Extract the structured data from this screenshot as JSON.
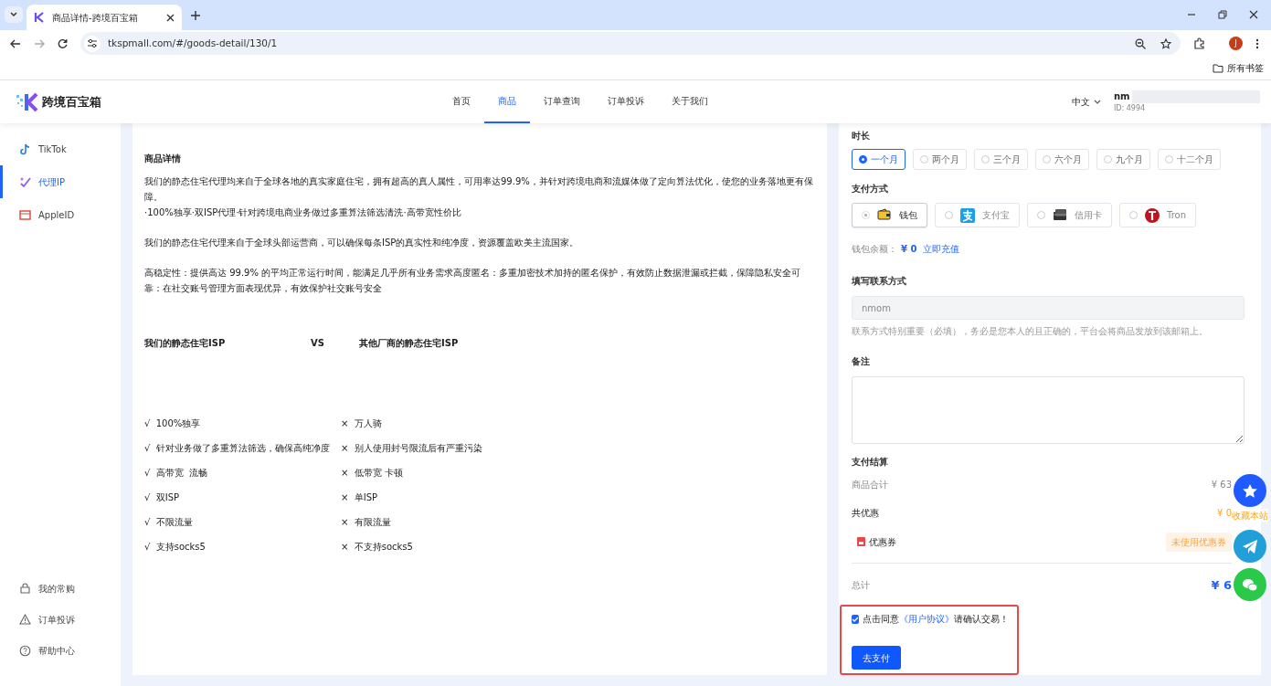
{
  "browser": {
    "tab_title": "商品详情-跨境百宝箱",
    "url": "tkspmall.com/#/goods-detail/130/1",
    "profile_initial": "J",
    "bookmarks_label": "所有书签"
  },
  "header": {
    "logo_text": "跨境百宝箱",
    "language": "中文",
    "user": {
      "name": "nm",
      "id": "ID: 4994"
    },
    "nav": [
      {
        "label": "首页",
        "selected": false
      },
      {
        "label": "商品",
        "selected": true
      },
      {
        "label": "订单查询",
        "selected": false
      },
      {
        "label": "订单投诉",
        "selected": false
      },
      {
        "label": "关于我们",
        "selected": false
      }
    ]
  },
  "sidebar": {
    "items": [
      {
        "label": "TikTok",
        "kind": "tiktok",
        "selected": false
      },
      {
        "label": "代理IP",
        "kind": "proxy",
        "selected": true
      },
      {
        "label": "AppleID",
        "kind": "apple",
        "selected": false
      }
    ],
    "bottom_items": [
      {
        "label": "我的常购",
        "kind": "bag"
      },
      {
        "label": "订单投诉",
        "kind": "warning"
      },
      {
        "label": "帮助中心",
        "kind": "help"
      }
    ]
  },
  "details": {
    "title": "商品详情",
    "paragraphs": [
      [
        "我们的静态住宅代理均来自于全球各地的真实家庭住宅，拥有超高的真人属性，可用率达99.9%，并针对跨境电商和流媒体做了定向算法优化，使您的业务落地更有保障。",
        "·100%独享·双ISP代理·针对跨境电商业务做过多重算法筛选清洗·高带宽性价比"
      ],
      [
        "我们的静态住宅代理来自于全球头部运营商，可以确保每条ISP的真实性和纯净度，资源覆盖欧美主流国家。"
      ],
      [
        "高稳定性：提供高达 99.9% 的平均正常运行时间，能满足几乎所有业务需求高度匿名：多重加密技术加持的匿名保护，有效防止数据泄漏或拦截，保障隐私安全可靠：在社交账号管理方面表现优异，有效保护社交账号安全"
      ]
    ],
    "compare": {
      "ours": "我们的静态住宅ISP",
      "vs": "VS",
      "theirs": "其他厂商的静态住宅ISP"
    },
    "rows": [
      {
        "pro": "√  100%独享",
        "con": "×  万人骑"
      },
      {
        "pro": "√  针对业务做了多重算法筛选，确保高纯净度",
        "con": "×  别人使用封号限流后有严重污染"
      },
      {
        "pro": "√  高带宽  流畅",
        "con": "×  低带宽 卡顿"
      },
      {
        "pro": "√  双ISP",
        "con": "×  单ISP"
      },
      {
        "pro": "√  不限流量",
        "con": "×  有限流量"
      },
      {
        "pro": "√  支持socks5",
        "con": "×  不支持socks5"
      }
    ]
  },
  "order": {
    "duration": {
      "label": "时长",
      "options": [
        {
          "label": "一个月",
          "selected": true
        },
        {
          "label": "两个月",
          "selected": false
        },
        {
          "label": "三个月",
          "selected": false
        },
        {
          "label": "六个月",
          "selected": false
        },
        {
          "label": "九个月",
          "selected": false
        },
        {
          "label": "十二个月",
          "selected": false
        }
      ]
    },
    "payment": {
      "label": "支付方式",
      "options": [
        {
          "label": "钱包",
          "kind": "wallet",
          "selected": true
        },
        {
          "label": "支付宝",
          "kind": "alipay",
          "selected": false
        },
        {
          "label": "信用卡",
          "kind": "card",
          "selected": false
        },
        {
          "label": "Tron",
          "kind": "tron",
          "selected": false
        }
      ]
    },
    "balance": {
      "label": "钱包余额：",
      "amount": "¥ 0",
      "recharge": "立即充值"
    },
    "contact": {
      "label": "填写联系方式",
      "value": "nmom",
      "hint": "联系方式特别重要（必填），务必是您本人的且正确的，平台会将商品发放到该邮箱上。"
    },
    "remark": {
      "label": "备注"
    },
    "settlement": {
      "label": "支付结算",
      "subtotal_label": "商品合计",
      "subtotal": "¥ 63",
      "discount_label": "共优惠",
      "discount": "¥ 0",
      "coupon_label": "优惠券",
      "coupon_status": "未使用优惠券",
      "total_label": "总计",
      "total": "¥ 6"
    },
    "agreement": {
      "checked": true,
      "highlighted": true,
      "before": "点击同意",
      "link": "《用户协议》",
      "after": "请确认交易！"
    },
    "pay_button": "去支付"
  },
  "floating": [
    {
      "kind": "star",
      "caption": "收藏本站"
    },
    {
      "kind": "telegram"
    },
    {
      "kind": "wechat"
    }
  ]
}
